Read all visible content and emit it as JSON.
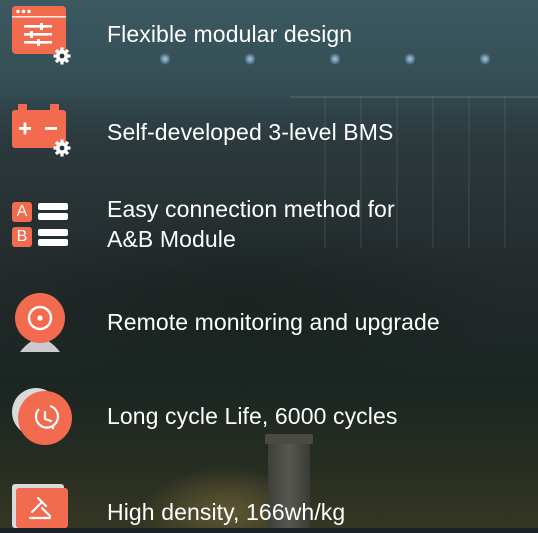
{
  "colors": {
    "accent": "#f26b4e",
    "accent_light": "#f6a08b",
    "text": "#ffffff"
  },
  "features": [
    {
      "icon": "modular-settings-window-icon",
      "label": "Flexible modular design"
    },
    {
      "icon": "battery-gear-icon",
      "label": "Self-developed 3-level BMS"
    },
    {
      "icon": "ab-module-connection-icon",
      "label_line1": "Easy connection method for",
      "label_line2": "A&B Module",
      "badge_a": "A",
      "badge_b": "B"
    },
    {
      "icon": "remote-camera-icon",
      "label": "Remote monitoring and upgrade"
    },
    {
      "icon": "cycle-clock-icon",
      "label": "Long cycle Life, 6000 cycles"
    },
    {
      "icon": "density-scale-icon",
      "label": "High density, 166wh/kg"
    }
  ]
}
